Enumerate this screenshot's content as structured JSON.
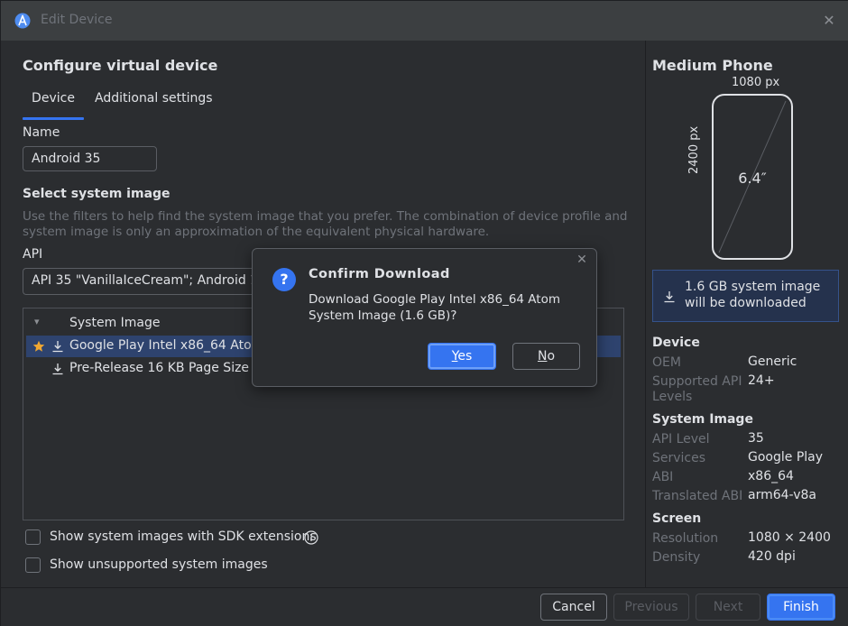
{
  "window": {
    "title": "Edit Device"
  },
  "left": {
    "heading": "Configure virtual device",
    "tabs": [
      {
        "label": "Device",
        "active": true
      },
      {
        "label": "Additional settings",
        "active": false
      }
    ],
    "name_label": "Name",
    "name_value": "Android 35",
    "system_image_heading": "Select system image",
    "system_image_hint_line1": "Use the filters to help find the system image that you prefer. The combination of device profile and",
    "system_image_hint_line2": "system image is only an approximation of the equivalent physical hardware.",
    "api_label": "API",
    "api_value": "API 35 \"VanillaIceCream\"; Android 15.0",
    "table": {
      "header": "System Image",
      "rows": [
        {
          "label": "Google Play Intel x86_64 Atom S",
          "starred": true,
          "selected": true
        },
        {
          "label": "Pre-Release 16 KB Page Size Go",
          "starred": false,
          "selected": false
        }
      ]
    },
    "checkboxes": [
      {
        "label": "Show system images with SDK extensions",
        "checked": false
      },
      {
        "label": "Show unsupported system images",
        "checked": false
      }
    ]
  },
  "right": {
    "device_title": "Medium Phone",
    "width_px": "1080 px",
    "height_px": "2400 px",
    "diagonal": "6.4″",
    "download_notice": "1.6 GB system image will be downloaded",
    "device_section": "Device",
    "oem_key": "OEM",
    "oem_val": "Generic",
    "api_key": "Supported API Levels",
    "api_val": "24+",
    "system_section": "System Image",
    "api_level_key": "API Level",
    "api_level_val": "35",
    "services_key": "Services",
    "services_val": "Google Play",
    "abi_key": "ABI",
    "abi_val": "x86_64",
    "tabi_key": "Translated ABI",
    "tabi_val": "arm64-v8a",
    "screen_section": "Screen",
    "res_key": "Resolution",
    "res_val": "1080 × 2400",
    "density_key": "Density",
    "density_val": "420 dpi"
  },
  "footer": {
    "cancel": "Cancel",
    "previous": "Previous",
    "next": "Next",
    "finish": "Finish"
  },
  "dialog": {
    "title": "Confirm Download",
    "message": "Download Google Play Intel x86_64 Atom System Image (1.6 GB)?",
    "yes_first": "Y",
    "yes_rest": "es",
    "no_first": "N",
    "no_rest": "o"
  },
  "colors": {
    "accent": "#3574f0",
    "background": "#2b2d30",
    "titlebar": "#3c3f41",
    "star": "#f0a732",
    "muted": "#6f737a"
  }
}
